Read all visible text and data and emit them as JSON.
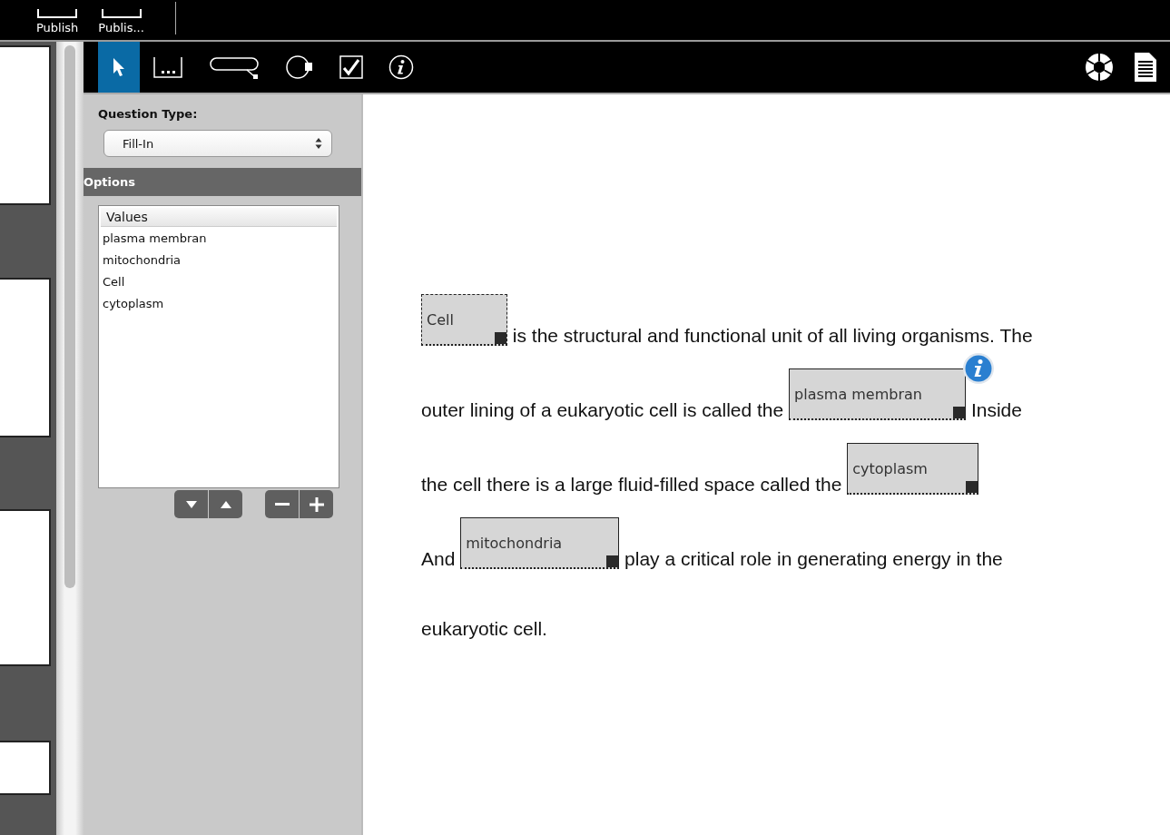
{
  "top_bar": {
    "buttons": [
      {
        "label": "Publish"
      },
      {
        "label": "Publis..."
      }
    ]
  },
  "tools": [
    {
      "kind": "pointer",
      "selected": true
    },
    {
      "kind": "fillin",
      "selected": false
    },
    {
      "kind": "callout",
      "selected": false
    },
    {
      "kind": "hotspot",
      "selected": false
    },
    {
      "kind": "checkbox",
      "selected": false
    },
    {
      "kind": "info",
      "selected": false
    }
  ],
  "panel": {
    "question_type_label": "Question Type:",
    "question_type": "Fill-In",
    "options_header": "Options",
    "values_header": "Values",
    "values": [
      "plasma membran",
      "mitochondria",
      "Cell",
      "cytoplasm"
    ]
  },
  "question": {
    "lines": [
      [
        {
          "kind": "blank",
          "answer": "Cell",
          "selected": true,
          "info": false
        },
        {
          "kind": "text",
          "text": " is the structural and functional unit of all living organisms. The"
        }
      ],
      [
        {
          "kind": "text",
          "text": "outer lining of a eukaryotic cell is called the "
        },
        {
          "kind": "blank",
          "answer": "plasma membran",
          "selected": false,
          "info": true
        },
        {
          "kind": "text",
          "text": " Inside"
        }
      ],
      [
        {
          "kind": "text",
          "text": "the cell there is a large fluid-filled space called the "
        },
        {
          "kind": "blank",
          "answer": "cytoplasm",
          "selected": false,
          "info": false
        }
      ],
      [
        {
          "kind": "text",
          "text": "And "
        },
        {
          "kind": "blank",
          "answer": "mitochondria",
          "selected": false,
          "info": false
        },
        {
          "kind": "text",
          "text": " play a critical role in generating energy in the"
        }
      ],
      [
        {
          "kind": "text",
          "text": "eukaryotic cell."
        }
      ]
    ]
  }
}
